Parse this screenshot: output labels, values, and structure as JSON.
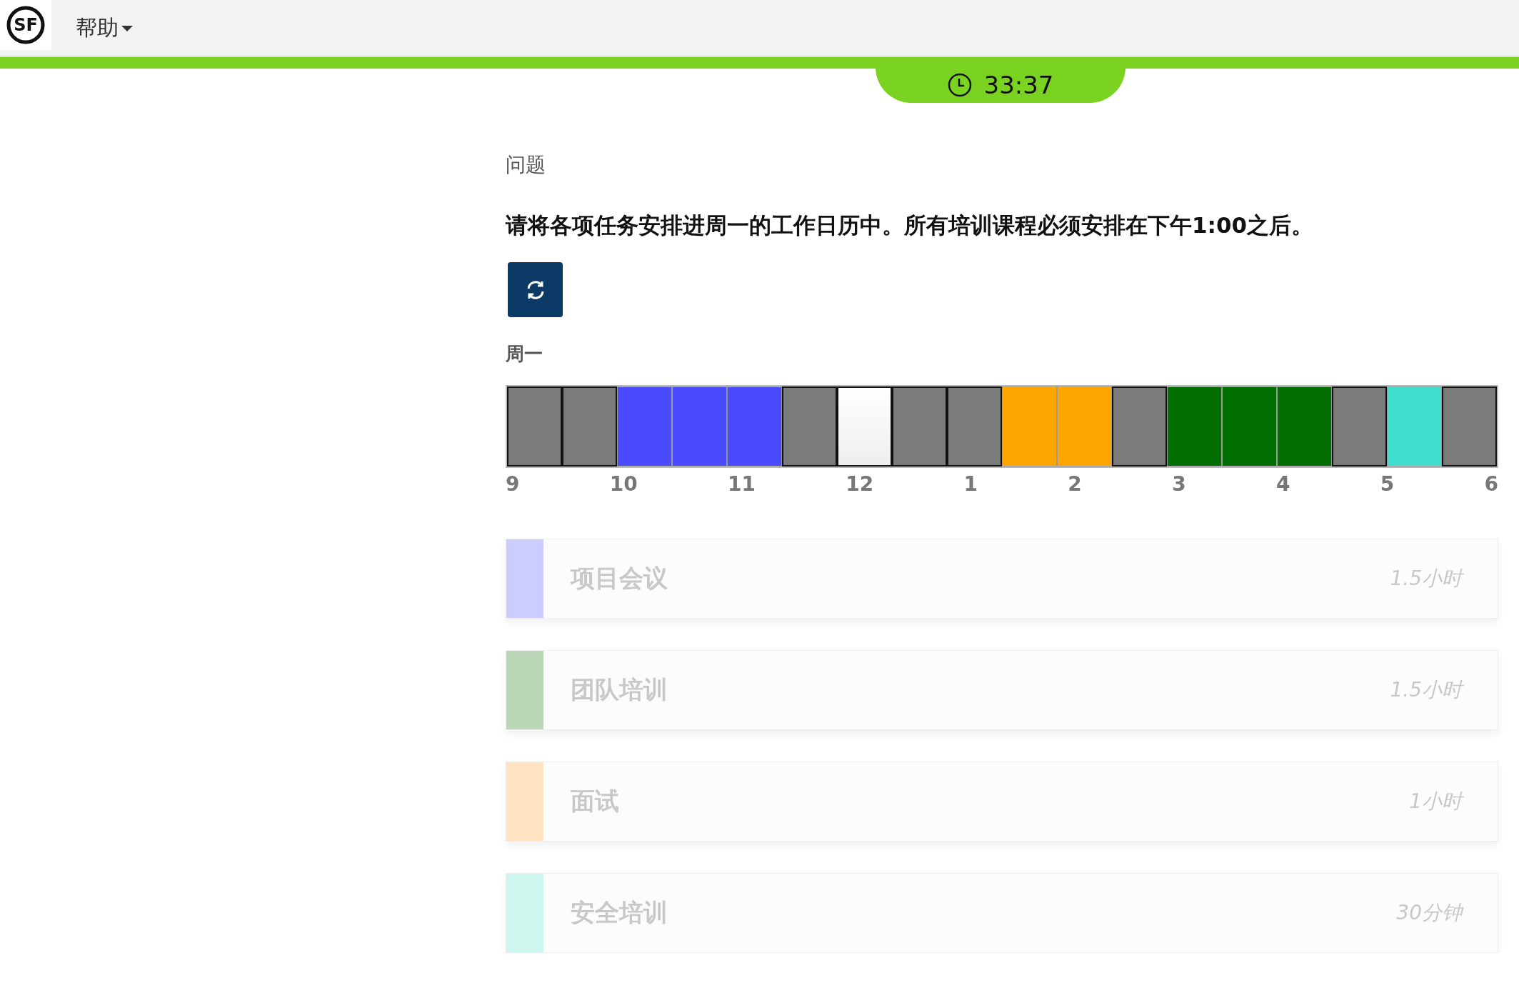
{
  "header": {
    "logo": "SF",
    "menu": "帮助"
  },
  "timer": "33:37",
  "section_label": "问题",
  "question": "请将各项任务安排进周一的工作日历中。所有培训课程必须安排在下午1:00之后。",
  "calendar": {
    "day": "周一",
    "slots": [
      {
        "kind": "blocked",
        "color": "#7b7b7b"
      },
      {
        "kind": "blocked",
        "color": "#7b7b7b"
      },
      {
        "kind": "task",
        "color": "#4a4aff"
      },
      {
        "kind": "task",
        "color": "#4a4aff"
      },
      {
        "kind": "task",
        "color": "#4a4aff"
      },
      {
        "kind": "blocked",
        "color": "#7b7b7b"
      },
      {
        "kind": "open",
        "color": "#f7f7f7"
      },
      {
        "kind": "blocked",
        "color": "#7b7b7b"
      },
      {
        "kind": "blocked",
        "color": "#7b7b7b"
      },
      {
        "kind": "task",
        "color": "#ffa500"
      },
      {
        "kind": "task",
        "color": "#ffa500"
      },
      {
        "kind": "blocked",
        "color": "#7b7b7b"
      },
      {
        "kind": "task",
        "color": "#006e00"
      },
      {
        "kind": "task",
        "color": "#006e00"
      },
      {
        "kind": "task",
        "color": "#006e00"
      },
      {
        "kind": "blocked",
        "color": "#7b7b7b"
      },
      {
        "kind": "task",
        "color": "#40e0d0"
      },
      {
        "kind": "blocked",
        "color": "#7b7b7b"
      }
    ],
    "hours": [
      "9",
      "10",
      "11",
      "12",
      "1",
      "2",
      "3",
      "4",
      "5",
      "6"
    ]
  },
  "tasks": [
    {
      "title": "项目会议",
      "duration": "1.5小时",
      "color": "#ccccff"
    },
    {
      "title": "团队培训",
      "duration": "1.5小时",
      "color": "#bcd6b8"
    },
    {
      "title": "面试",
      "duration": "1小时",
      "color": "#ffe2c0"
    },
    {
      "title": "安全培训",
      "duration": "30分钟",
      "color": "#cdf6ef"
    }
  ]
}
